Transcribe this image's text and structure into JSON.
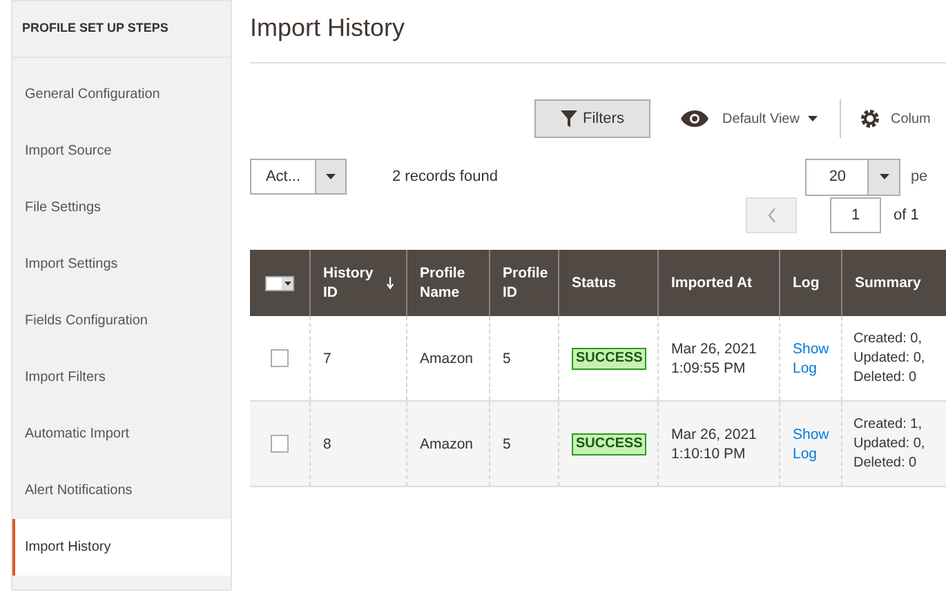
{
  "sidebar": {
    "title": "PROFILE SET UP STEPS",
    "items": [
      {
        "label": "General Configuration",
        "selected": false
      },
      {
        "label": "Import Source",
        "selected": false
      },
      {
        "label": "File Settings",
        "selected": false
      },
      {
        "label": "Import Settings",
        "selected": false
      },
      {
        "label": "Fields Configuration",
        "selected": false
      },
      {
        "label": "Import Filters",
        "selected": false
      },
      {
        "label": "Automatic Import",
        "selected": false
      },
      {
        "label": "Alert Notifications",
        "selected": false
      },
      {
        "label": "Import History",
        "selected": true
      }
    ]
  },
  "page": {
    "title": "Import History"
  },
  "toolbar": {
    "filters": "Filters",
    "view": "Default View",
    "columns": "Colum"
  },
  "actions": {
    "value": "Act..."
  },
  "records": "2 records found",
  "pagination": {
    "per_page": "20",
    "per_page_label": "pe",
    "page": "1",
    "of": "of 1"
  },
  "table": {
    "all_checked": false,
    "columns": [
      "History ID",
      "Profile Name",
      "Profile ID",
      "Status",
      "Imported At",
      "Log",
      "Summary"
    ],
    "rows": [
      {
        "checked": false,
        "history_id": "7",
        "profile_name": "Amazon",
        "profile_id": "5",
        "status": "SUCCESS",
        "imported_at": "Mar 26, 2021 1:09:55 PM",
        "log": "Show Log",
        "summary": "Created: 0, Updated: 0, Deleted: 0"
      },
      {
        "checked": false,
        "history_id": "8",
        "profile_name": "Amazon",
        "profile_id": "5",
        "status": "SUCCESS",
        "imported_at": "Mar 26, 2021 1:10:10 PM",
        "log": "Show Log",
        "summary": "Created: 1, Updated: 0, Deleted: 0"
      }
    ]
  }
}
